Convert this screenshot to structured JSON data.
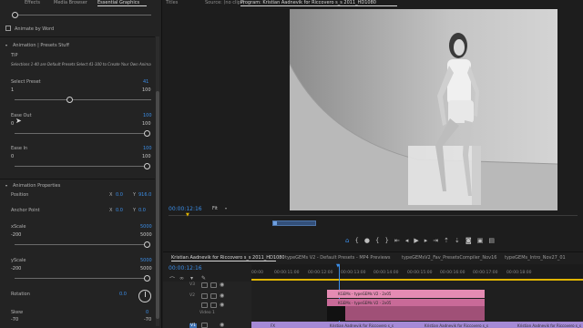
{
  "left_panel": {
    "tabs": [
      "Effects",
      "Media Browser",
      "Essential Graphics"
    ],
    "animate_by_word": "Animate by Word",
    "section_title": "Animation | Presets Stuff",
    "tip_label": "TIP",
    "tip_text": "Selections 1-40 are Default Presets  Select 41-100  to Create Your Own Anima",
    "select_preset": {
      "label": "Select Preset",
      "max": "41",
      "min": "1",
      "value": "100"
    },
    "ease_out": {
      "label": "Ease Out",
      "max": "100",
      "min": "0",
      "value": "100"
    },
    "ease_in": {
      "label": "Ease In",
      "max": "100",
      "min": "0",
      "value": "100"
    },
    "properties_title": "Animation Properties",
    "position": {
      "label": "Position",
      "x_label": "X",
      "x": "0.0",
      "y_label": "Y",
      "y": "916.0"
    },
    "anchor": {
      "label": "Anchor Point",
      "x_label": "X",
      "x": "0.0",
      "y_label": "Y",
      "y": "0.0"
    },
    "xscale": {
      "label": "xScale",
      "value": "5000",
      "min": "-200",
      "max": "5000"
    },
    "yscale": {
      "label": "yScale",
      "value": "5000",
      "min": "-200",
      "max": "5000"
    },
    "rotation": {
      "label": "Rotation",
      "value": "0.0"
    },
    "skew": {
      "label": "Skew",
      "value": "0",
      "min": "-70",
      "max": "-70"
    }
  },
  "monitor": {
    "tabs": [
      "Titles",
      "Source: (no clips)",
      "Program: Kristian Aadnevik for Riccovero s_s 2011_HD1080"
    ],
    "timecode": "00:00:12:16",
    "fit": "Fit"
  },
  "timeline": {
    "tabs": [
      "Kristian Aadnevik for Riccovero s_s 2011_HD1080",
      "typeGEMs V2 - Default Presets - MP4 Previews",
      "typeGEMsV2_Fav_PresetsCompiler_Nov16",
      "typeGEMs_Intro_Nov27_01"
    ],
    "timecode": "00:00:12:16",
    "ticks": [
      "00:00",
      "00:00:11:00",
      "00:00:12:00",
      "00:00:13:00",
      "00:00:14:00",
      "00:00:15:00",
      "00:00:16:00",
      "00:00:17:00",
      "00:00:18:00"
    ],
    "tracks": [
      "V3",
      "V2",
      "V1"
    ],
    "video_track_name": "Video 1",
    "clips": {
      "pink": "KGEMs - typeGEMs V2 - 2x05",
      "pink2": "KGEMs - typeGEMs V2 - 2x05",
      "v1_a": "FX",
      "v1_b": "Kristian Aadnevik for Riccovero s_s 2011_",
      "v1_c": "Kristian Aadnevik for Riccovero s_s 2011_",
      "v1_d": "Kristian Aadnevik for Riccovero s_s 2011_HD1080"
    }
  },
  "colors": {
    "accent": "#3b8ee8",
    "clip_pink": "#e58bb3",
    "clip_magenta": "#c96a98",
    "clip_purple": "#a58ad6"
  }
}
